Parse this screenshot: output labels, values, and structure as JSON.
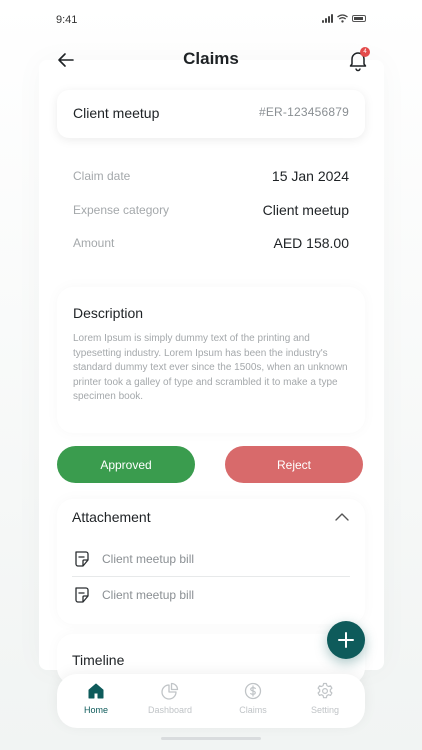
{
  "status_bar": {
    "time": "9:41"
  },
  "header": {
    "title": "Claims",
    "notification_count": "4"
  },
  "claim": {
    "name": "Client meetup",
    "id": "#ER-123456879"
  },
  "details": [
    {
      "label": "Claim date",
      "value": "15 Jan 2024"
    },
    {
      "label": "Expense category",
      "value": "Client meetup"
    },
    {
      "label": "Amount",
      "value": "AED 158.00"
    }
  ],
  "description": {
    "title": "Description",
    "text": "Lorem Ipsum is simply dummy text of the printing and typesetting industry. Lorem Ipsum has been the industry's standard dummy text ever since the 1500s, when an unknown printer took a galley of type and scrambled it to make a type specimen book."
  },
  "actions": {
    "approve_label": "Approved",
    "reject_label": "Reject"
  },
  "attachment": {
    "title": "Attachement",
    "items": [
      {
        "name": "Client meetup bill"
      },
      {
        "name": "Client meetup bill"
      }
    ]
  },
  "timeline": {
    "title": "Timeline"
  },
  "nav": [
    {
      "label": "Home",
      "icon": "home-icon",
      "active": true
    },
    {
      "label": "Dashboard",
      "icon": "pie-chart-icon",
      "active": false
    },
    {
      "label": "Claims",
      "icon": "dollar-circle-icon",
      "active": false
    },
    {
      "label": "Setting",
      "icon": "gear-icon",
      "active": false
    }
  ],
  "colors": {
    "primary": "#0e5b5b",
    "approve": "#3a9c4e",
    "reject": "#d86a6b",
    "badge": "#e34b4b"
  }
}
